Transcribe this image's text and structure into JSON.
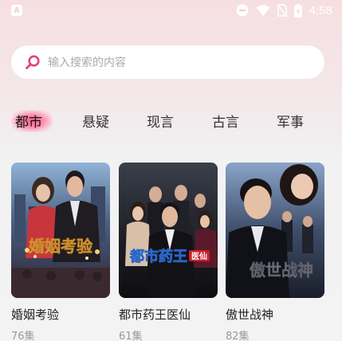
{
  "status_bar": {
    "app_letter": "A",
    "time": "4:58",
    "icons": [
      "dnd-icon",
      "wifi-icon",
      "no-sim-icon",
      "battery-icon"
    ]
  },
  "search": {
    "placeholder": "输入搜索的内容"
  },
  "tabs": [
    {
      "label": "都市",
      "active": true
    },
    {
      "label": "悬疑",
      "active": false
    },
    {
      "label": "现言",
      "active": false
    },
    {
      "label": "古言",
      "active": false
    },
    {
      "label": "军事",
      "active": false
    }
  ],
  "dramas": [
    {
      "title": "婚姻考验",
      "episodes": "76集",
      "poster_text": "婚姻考验"
    },
    {
      "title": "都市药王医仙",
      "episodes": "61集",
      "poster_text": "都市药王",
      "poster_badge": "医仙"
    },
    {
      "title": "傲世战神",
      "episodes": "82集",
      "poster_text": "傲世战神"
    }
  ],
  "colors": {
    "accent": "#ff5e8a",
    "search_icon": "#e0486e"
  }
}
